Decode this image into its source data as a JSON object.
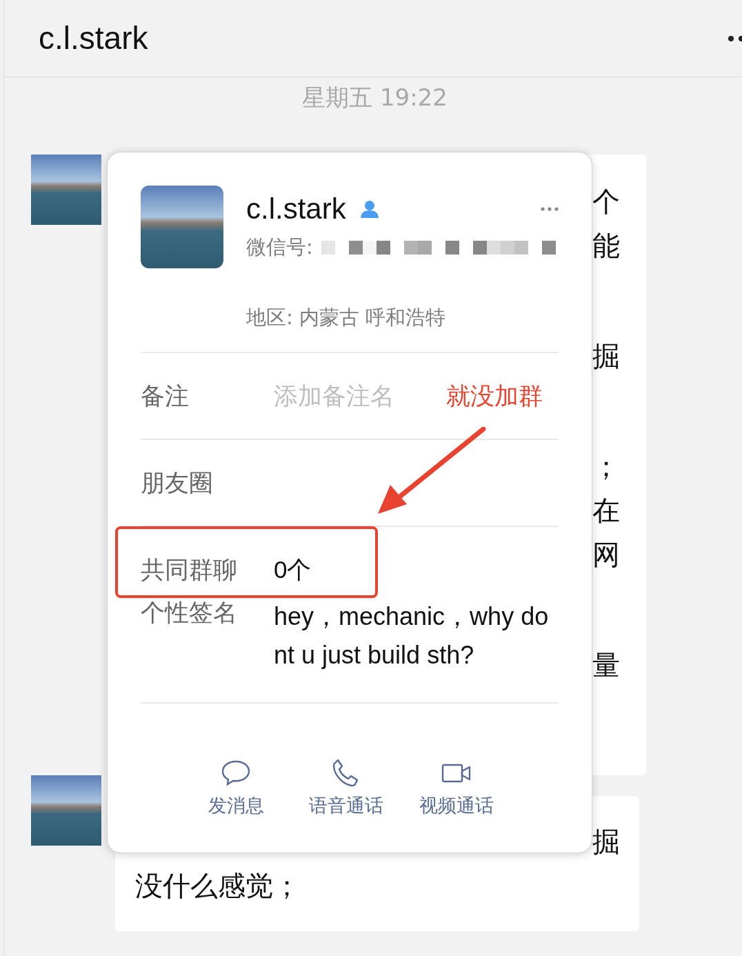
{
  "header": {
    "title": "c.l.stark"
  },
  "timestamp": "星期五 19:22",
  "messages": [
    {
      "groups": [
        [
          {
            "kind": "fragment",
            "text": "个"
          },
          {
            "kind": "fragment",
            "text": "能"
          }
        ],
        [
          {
            "kind": "fragment",
            "text": "掘"
          }
        ],
        [
          {
            "kind": "fragment",
            "text": "；"
          },
          {
            "kind": "fragment",
            "text": "在"
          },
          {
            "kind": "fragment",
            "text": "网"
          }
        ],
        [
          {
            "kind": "fragment",
            "text": "量"
          }
        ]
      ]
    },
    {
      "groups": [
        [
          {
            "kind": "fragment",
            "text": "掘"
          },
          {
            "kind": "line",
            "text": "没什么感觉；"
          }
        ]
      ]
    }
  ],
  "profile_card": {
    "name": "c.l.stark",
    "wechat_id_label": "微信号:",
    "region": "地区: 内蒙古 呼和浩特",
    "rows": [
      {
        "kind": "input",
        "label": "备注",
        "placeholder": "添加备注名",
        "divider": true
      },
      {
        "kind": "link",
        "label": "朋友圈",
        "divider": true
      },
      {
        "kind": "value",
        "label": "共同群聊",
        "value": "0个",
        "divider": false
      },
      {
        "kind": "value",
        "label": "个性签名",
        "value": "hey，mechanic，why dont u just build sth?",
        "divider": true
      }
    ],
    "actions": [
      {
        "kind": "message",
        "label": "发消息"
      },
      {
        "kind": "voice",
        "label": "语音通话"
      },
      {
        "kind": "video",
        "label": "视频通话"
      }
    ]
  },
  "annotations": {
    "note": "就没加群"
  }
}
